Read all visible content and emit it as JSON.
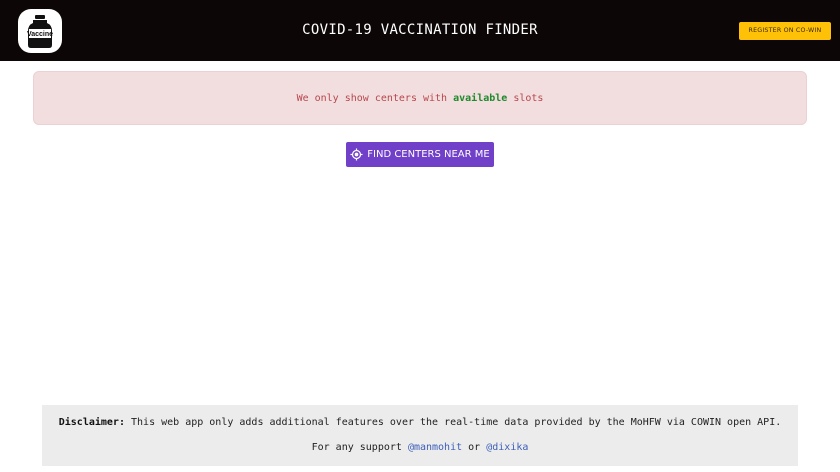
{
  "header": {
    "logo_text": "Vaccine",
    "title": "COVID-19 VACCINATION FINDER",
    "register_label": "REGISTER ON CO-WIN"
  },
  "alert": {
    "prefix": "We only show centers with",
    "highlight": "available",
    "suffix": "slots"
  },
  "find_button": {
    "icon": "locate-icon",
    "label": "FIND CENTERS NEAR ME"
  },
  "footer": {
    "disclaimer_label": "Disclaimer:",
    "disclaimer_text": "This web app only adds additional features over the real-time data provided by the MoHFW via COWIN open API.",
    "support_prefix": "For any support",
    "support_link_1": "@manmohit",
    "support_or": "or",
    "support_link_2": "@dixika"
  },
  "colors": {
    "header_bg": "#0d0607",
    "register_bg": "#ffc107",
    "alert_bg": "#f2dedf",
    "alert_text": "#b8474c",
    "highlight": "#1e8a2a",
    "button_bg": "#7040c8",
    "footer_bg": "#ececec",
    "link": "#3d5fb8"
  }
}
